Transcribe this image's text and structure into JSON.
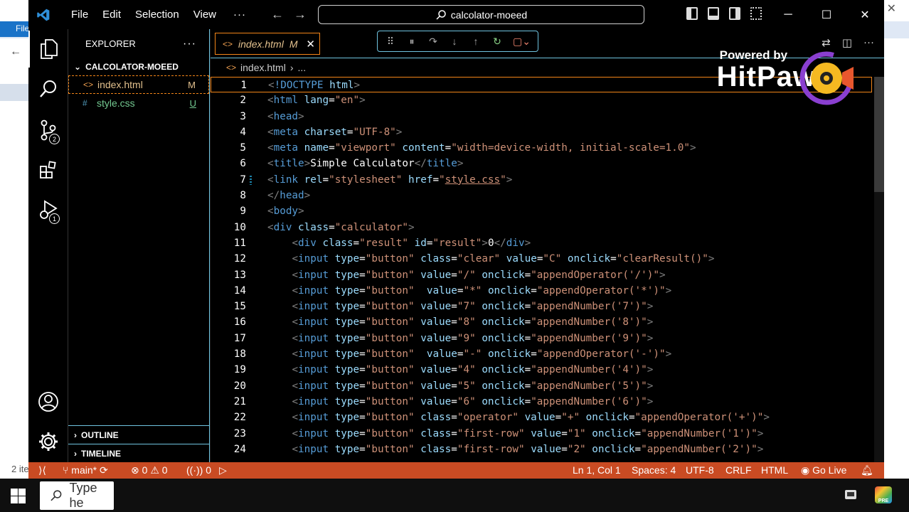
{
  "window": {
    "title": "calcolator-moeed",
    "menu": [
      "File",
      "Edit",
      "Selection",
      "View"
    ],
    "menu_more": "···",
    "controls": {
      "minimize": "─",
      "maximize": "☐",
      "close": "✕"
    }
  },
  "background": {
    "file_tab": "File",
    "status": "2 ite",
    "search_text": "Type he"
  },
  "activity_bar": {
    "items": [
      {
        "name": "explorer-icon",
        "active": true
      },
      {
        "name": "search-icon"
      },
      {
        "name": "source-control-icon",
        "badge": "2"
      },
      {
        "name": "extensions-icon"
      },
      {
        "name": "run-debug-icon",
        "badge": "1"
      }
    ]
  },
  "sidebar": {
    "header": "EXPLORER",
    "header_more": "···",
    "folder": "CALCOLATOR-MOEED",
    "files": [
      {
        "name": "index.html",
        "status": "M",
        "icon": "<>"
      },
      {
        "name": "style.css",
        "status": "U",
        "icon": "#"
      }
    ],
    "sections": [
      "OUTLINE",
      "TIMELINE"
    ]
  },
  "editor": {
    "tab_label": "index.html",
    "tab_status": "M",
    "breadcrumb_file": "index.html",
    "breadcrumb_more": "...",
    "lines": [
      {
        "n": "1",
        "html": "<span class='g'>&lt;</span><span class='t'>!DOCTYPE</span> <span class='a'>html</span><span class='g'>&gt;</span>"
      },
      {
        "n": "2",
        "html": "<span class='g'>&lt;</span><span class='t'>html</span> <span class='a'>lang</span><span class='w'>=</span><span class='s'>\"en\"</span><span class='g'>&gt;</span>"
      },
      {
        "n": "3",
        "html": "<span class='g'>&lt;</span><span class='t'>head</span><span class='g'>&gt;</span>"
      },
      {
        "n": "4",
        "html": "<span class='g'>&lt;</span><span class='t'>meta</span> <span class='a'>charset</span><span class='w'>=</span><span class='s'>\"UTF-8\"</span><span class='g'>&gt;</span>"
      },
      {
        "n": "5",
        "html": "<span class='g'>&lt;</span><span class='t'>meta</span> <span class='a'>name</span><span class='w'>=</span><span class='s'>\"viewport\"</span> <span class='a'>content</span><span class='w'>=</span><span class='s'>\"width=device-width, initial-scale=1.0\"</span><span class='g'>&gt;</span>"
      },
      {
        "n": "6",
        "html": "<span class='g'>&lt;</span><span class='t'>title</span><span class='g'>&gt;</span><span class='w'>Simple Calculator</span><span class='g'>&lt;/</span><span class='t'>title</span><span class='g'>&gt;</span>"
      },
      {
        "n": "7",
        "html": "<span class='g'>&lt;</span><span class='t'>link</span> <span class='a'>rel</span><span class='w'>=</span><span class='s'>\"stylesheet\"</span> <span class='a'>href</span><span class='w'>=</span><span class='s'>\"<span class='u'>style.css</span>\"</span><span class='g'>&gt;</span>"
      },
      {
        "n": "8",
        "html": "<span class='g'>&lt;/</span><span class='t'>head</span><span class='g'>&gt;</span>"
      },
      {
        "n": "9",
        "html": "<span class='g'>&lt;</span><span class='t'>body</span><span class='g'>&gt;</span>"
      },
      {
        "n": "10",
        "html": "<span class='g'>&lt;</span><span class='t'>div</span> <span class='a'>class</span><span class='w'>=</span><span class='s'>\"calculator\"</span><span class='g'>&gt;</span>"
      },
      {
        "n": "11",
        "html": "    <span class='g'>&lt;</span><span class='t'>div</span> <span class='a'>class</span><span class='w'>=</span><span class='s'>\"result\"</span> <span class='a'>id</span><span class='w'>=</span><span class='s'>\"result\"</span><span class='g'>&gt;</span><span class='w'>0</span><span class='g'>&lt;/</span><span class='t'>div</span><span class='g'>&gt;</span>"
      },
      {
        "n": "12",
        "html": "    <span class='g'>&lt;</span><span class='t'>input</span> <span class='a'>type</span><span class='w'>=</span><span class='s'>\"button\"</span> <span class='a'>class</span><span class='w'>=</span><span class='s'>\"clear\"</span> <span class='a'>value</span><span class='w'>=</span><span class='s'>\"C\"</span> <span class='a'>onclick</span><span class='w'>=</span><span class='s'>\"clearResult()\"</span><span class='g'>&gt;</span>"
      },
      {
        "n": "13",
        "html": "    <span class='g'>&lt;</span><span class='t'>input</span> <span class='a'>type</span><span class='w'>=</span><span class='s'>\"button\"</span> <span class='a'>value</span><span class='w'>=</span><span class='s'>\"/\"</span> <span class='a'>onclick</span><span class='w'>=</span><span class='s'>\"appendOperator('/')\"</span><span class='g'>&gt;</span>"
      },
      {
        "n": "14",
        "html": "    <span class='g'>&lt;</span><span class='t'>input</span> <span class='a'>type</span><span class='w'>=</span><span class='s'>\"button\"</span>  <span class='a'>value</span><span class='w'>=</span><span class='s'>\"*\"</span> <span class='a'>onclick</span><span class='w'>=</span><span class='s'>\"appendOperator('*')\"</span><span class='g'>&gt;</span>"
      },
      {
        "n": "15",
        "html": "    <span class='g'>&lt;</span><span class='t'>input</span> <span class='a'>type</span><span class='w'>=</span><span class='s'>\"button\"</span> <span class='a'>value</span><span class='w'>=</span><span class='s'>\"7\"</span> <span class='a'>onclick</span><span class='w'>=</span><span class='s'>\"appendNumber('7')\"</span><span class='g'>&gt;</span>"
      },
      {
        "n": "16",
        "html": "    <span class='g'>&lt;</span><span class='t'>input</span> <span class='a'>type</span><span class='w'>=</span><span class='s'>\"button\"</span> <span class='a'>value</span><span class='w'>=</span><span class='s'>\"8\"</span> <span class='a'>onclick</span><span class='w'>=</span><span class='s'>\"appendNumber('8')\"</span><span class='g'>&gt;</span>"
      },
      {
        "n": "17",
        "html": "    <span class='g'>&lt;</span><span class='t'>input</span> <span class='a'>type</span><span class='w'>=</span><span class='s'>\"button\"</span> <span class='a'>value</span><span class='w'>=</span><span class='s'>\"9\"</span> <span class='a'>onclick</span><span class='w'>=</span><span class='s'>\"appendNumber('9')\"</span><span class='g'>&gt;</span>"
      },
      {
        "n": "18",
        "html": "    <span class='g'>&lt;</span><span class='t'>input</span> <span class='a'>type</span><span class='w'>=</span><span class='s'>\"button\"</span>  <span class='a'>value</span><span class='w'>=</span><span class='s'>\"-\"</span> <span class='a'>onclick</span><span class='w'>=</span><span class='s'>\"appendOperator('-')\"</span><span class='g'>&gt;</span>"
      },
      {
        "n": "19",
        "html": "    <span class='g'>&lt;</span><span class='t'>input</span> <span class='a'>type</span><span class='w'>=</span><span class='s'>\"button\"</span> <span class='a'>value</span><span class='w'>=</span><span class='s'>\"4\"</span> <span class='a'>onclick</span><span class='w'>=</span><span class='s'>\"appendNumber('4')\"</span><span class='g'>&gt;</span>"
      },
      {
        "n": "20",
        "html": "    <span class='g'>&lt;</span><span class='t'>input</span> <span class='a'>type</span><span class='w'>=</span><span class='s'>\"button\"</span> <span class='a'>value</span><span class='w'>=</span><span class='s'>\"5\"</span> <span class='a'>onclick</span><span class='w'>=</span><span class='s'>\"appendNumber('5')\"</span><span class='g'>&gt;</span>"
      },
      {
        "n": "21",
        "html": "    <span class='g'>&lt;</span><span class='t'>input</span> <span class='a'>type</span><span class='w'>=</span><span class='s'>\"button\"</span> <span class='a'>value</span><span class='w'>=</span><span class='s'>\"6\"</span> <span class='a'>onclick</span><span class='w'>=</span><span class='s'>\"appendNumber('6')\"</span><span class='g'>&gt;</span>"
      },
      {
        "n": "22",
        "html": "    <span class='g'>&lt;</span><span class='t'>input</span> <span class='a'>type</span><span class='w'>=</span><span class='s'>\"button\"</span> <span class='a'>class</span><span class='w'>=</span><span class='s'>\"operator\"</span> <span class='a'>value</span><span class='w'>=</span><span class='s'>\"+\"</span> <span class='a'>onclick</span><span class='w'>=</span><span class='s'>\"appendOperator('+')\"</span><span class='g'>&gt;</span>"
      },
      {
        "n": "23",
        "html": "    <span class='g'>&lt;</span><span class='t'>input</span> <span class='a'>type</span><span class='w'>=</span><span class='s'>\"button\"</span> <span class='a'>class</span><span class='w'>=</span><span class='s'>\"first-row\"</span> <span class='a'>value</span><span class='w'>=</span><span class='s'>\"1\"</span> <span class='a'>onclick</span><span class='w'>=</span><span class='s'>\"appendNumber('1')\"</span><span class='g'>&gt;</span>"
      },
      {
        "n": "24",
        "html": "    <span class='g'>&lt;</span><span class='t'>input</span> <span class='a'>type</span><span class='w'>=</span><span class='s'>\"button\"</span> <span class='a'>class</span><span class='w'>=</span><span class='s'>\"first-row\"</span> <span class='a'>value</span><span class='w'>=</span><span class='s'>\"2\"</span> <span class='a'>onclick</span><span class='w'>=</span><span class='s'>\"appendNumber('2')\"</span><span class='g'>&gt;</span>"
      }
    ]
  },
  "watermark": {
    "line1": "Powered by",
    "line2": "HitPaw"
  },
  "statusbar": {
    "branch": "main*",
    "errors": "0",
    "warnings": "0",
    "ports": "0",
    "position": "Ln 1, Col 1",
    "spaces": "Spaces: 4",
    "encoding": "UTF-8",
    "eol": "CRLF",
    "language": "HTML",
    "golive": "Go Live"
  },
  "colors": {
    "accent_border": "#6fc3df",
    "focus_border": "#f38518",
    "statusbar_bg": "#c94b23"
  }
}
